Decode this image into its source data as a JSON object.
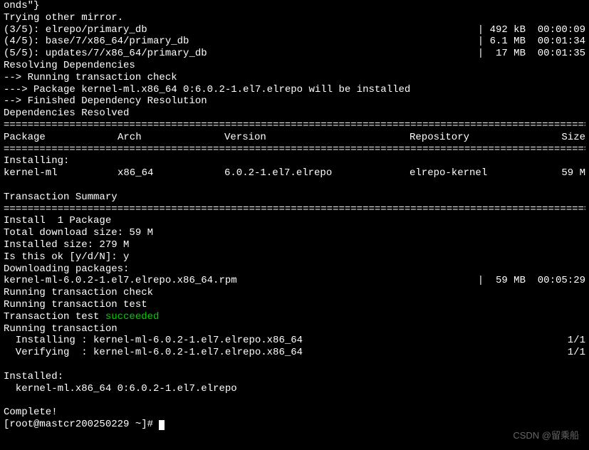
{
  "top_lines": [
    "onds\"}",
    "Trying other mirror."
  ],
  "downloads": [
    {
      "label": "(3/5): elrepo/primary_db",
      "size": "| 492 kB  00:00:09"
    },
    {
      "label": "(4/5): base/7/x86_64/primary_db",
      "size": "| 6.1 MB  00:01:34"
    },
    {
      "label": "(5/5): updates/7/x86_64/primary_db",
      "size": "|  17 MB  00:01:35"
    }
  ],
  "resolve_lines": [
    "Resolving Dependencies",
    "--> Running transaction check",
    "---> Package kernel-ml.x86_64 0:6.0.2-1.el7.elrepo will be installed",
    "--> Finished Dependency Resolution",
    "",
    "Dependencies Resolved",
    ""
  ],
  "separator": "==========================================================================================================",
  "headers": {
    "package": " Package",
    "arch": "Arch",
    "version": "Version",
    "repository": "Repository",
    "size": "Size"
  },
  "installing_label": "Installing:",
  "pkg_row": {
    "package": " kernel-ml",
    "arch": "x86_64",
    "version": "6.0.2-1.el7.elrepo",
    "repository": "elrepo-kernel",
    "size": "59 M"
  },
  "tx_summary_label": "Transaction Summary",
  "install_count": "Install  1 Package",
  "post_lines": [
    "",
    "Total download size: 59 M",
    "Installed size: 279 M",
    "Is this ok [y/d/N]: y",
    "Downloading packages:"
  ],
  "rpm_download": {
    "label": "kernel-ml-6.0.2-1.el7.elrepo.x86_64.rpm",
    "size": "|  59 MB  00:05:29"
  },
  "tx_lines": [
    "Running transaction check",
    "Running transaction test"
  ],
  "tx_test_prefix": "Transaction test ",
  "tx_test_status": "succeeded",
  "running_tx": "Running transaction",
  "install_steps": [
    {
      "label": "  Installing : kernel-ml-6.0.2-1.el7.elrepo.x86_64",
      "count": "1/1"
    },
    {
      "label": "  Verifying  : kernel-ml-6.0.2-1.el7.elrepo.x86_64",
      "count": "1/1"
    }
  ],
  "installed_label": "Installed:",
  "installed_pkg": "  kernel-ml.x86_64 0:6.0.2-1.el7.elrepo",
  "complete": "Complete!",
  "prompt": "[root@mastcr200250229 ~]# ",
  "watermark": "CSDN @留乘船"
}
